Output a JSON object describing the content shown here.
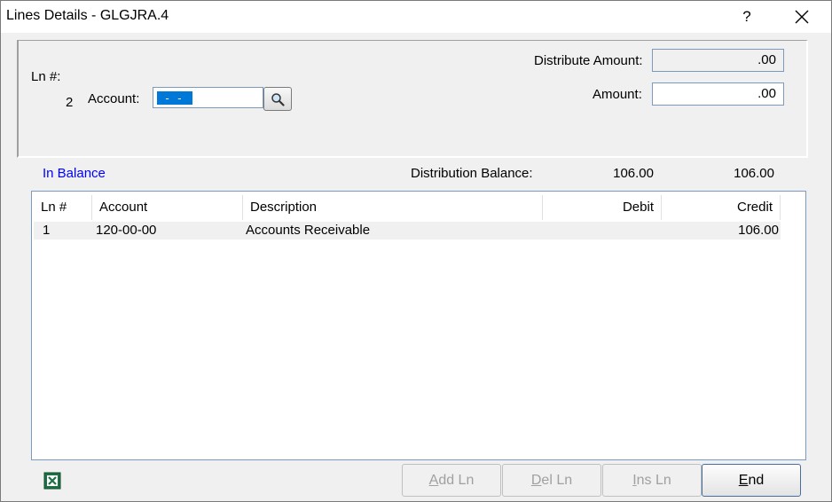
{
  "window": {
    "title": "Lines Details - GLGJRA.4",
    "help_label": "?"
  },
  "form": {
    "ln_label": "Ln #:",
    "ln_value": "2",
    "account_label": "Account:",
    "account_value": "- -",
    "distribute_amount_label": "Distribute Amount:",
    "distribute_amount_value": ".00",
    "amount_label": "Amount:",
    "amount_value": ".00"
  },
  "summary": {
    "status": "In Balance",
    "distribution_balance_label": "Distribution Balance:",
    "debit_total": "106.00",
    "credit_total": "106.00"
  },
  "grid": {
    "columns": [
      "Ln #",
      "Account",
      "Description",
      "Debit",
      "Credit"
    ],
    "rows": [
      {
        "ln": "1",
        "account": "120-00-00",
        "description": "Accounts Receivable",
        "debit": "",
        "credit": "106.00"
      }
    ]
  },
  "buttons": {
    "add": {
      "accel": "A",
      "rest": "dd Ln"
    },
    "del": {
      "accel": "D",
      "rest": "el Ln"
    },
    "ins": {
      "accel": "I",
      "rest": "ns Ln"
    },
    "end": {
      "accel": "E",
      "rest": "nd"
    }
  },
  "icons": {
    "excel": "excel-icon",
    "lookup": "magnifier-icon",
    "close": "close-icon"
  }
}
